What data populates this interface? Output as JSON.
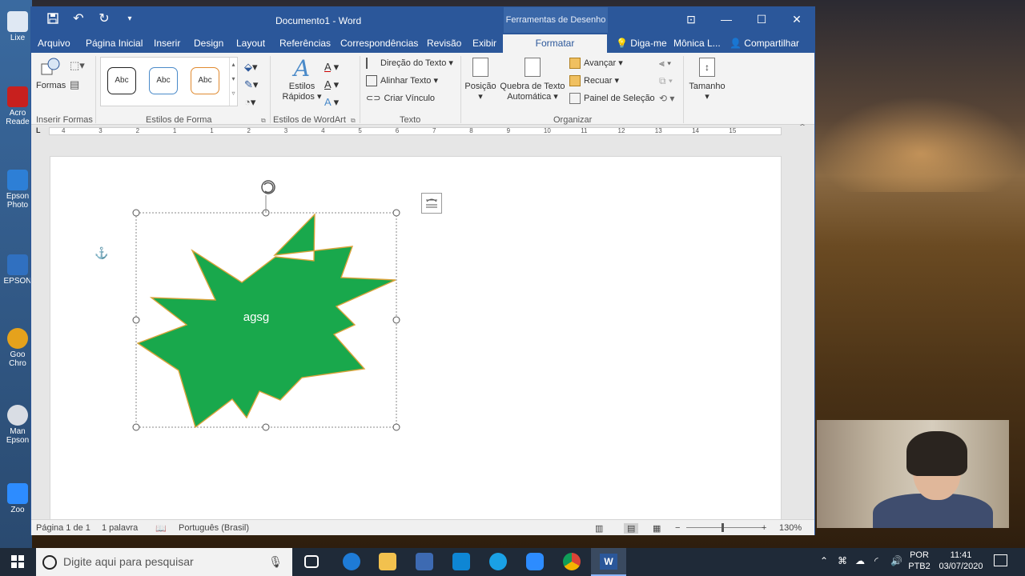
{
  "app": {
    "window_title": "Documento1 - Word",
    "context_tools": "Ferramentas de Desenho"
  },
  "tabs": {
    "arquivo": "Arquivo",
    "inicio": "Página Inicial",
    "inserir": "Inserir",
    "design": "Design",
    "layout": "Layout",
    "referencias": "Referências",
    "correspondencias": "Correspondências",
    "revisao": "Revisão",
    "exibir": "Exibir",
    "formatar": "Formatar",
    "diga_me": "Diga-me",
    "user": "Mônica L...",
    "compartilhar": "Compartilhar"
  },
  "ribbon": {
    "formas": "Formas",
    "style1": "Abc",
    "style2": "Abc",
    "style3": "Abc",
    "estilos": "Estilos",
    "rapidos": "Rápidos",
    "direcao_texto": "Direção do Texto",
    "alinhar_texto": "Alinhar Texto",
    "criar_vinculo": "Criar Vínculo",
    "posicao": "Posição",
    "quebra_texto": "Quebra de Texto",
    "automatica": "Automática",
    "avancar": "Avançar",
    "recuar": "Recuar",
    "painel_selecao": "Painel de Seleção",
    "tamanho": "Tamanho",
    "groups": {
      "inserir_formas": "Inserir Formas",
      "estilos_forma": "Estilos de Forma",
      "estilos_wordart": "Estilos de WordArt",
      "texto": "Texto",
      "organizar": "Organizar"
    }
  },
  "ruler": {
    "numbers": [
      "4",
      "3",
      "2",
      "1",
      "1",
      "2",
      "3",
      "4",
      "5",
      "6",
      "7",
      "8",
      "9",
      "10",
      "11",
      "12",
      "13",
      "14",
      "15"
    ],
    "vnumbers": [
      "3",
      "2",
      "1",
      "1",
      "2",
      "3",
      "4",
      "5",
      "6"
    ]
  },
  "document": {
    "shape_text": "agsg",
    "shape_fill": "#19a84c",
    "shape_outline": "#d9a33a"
  },
  "status": {
    "page": "Página 1 de 1",
    "words": "1 palavra",
    "language": "Português (Brasil)",
    "zoom": "130%"
  },
  "desktop_icons": [
    {
      "label": "Lixe",
      "color": "#dfe8f3"
    },
    {
      "label": "Acro Reade",
      "color": "#c8201e"
    },
    {
      "label": "Epson Photo",
      "color": "#2d7fd6"
    },
    {
      "label": "EPSON",
      "color": "#3070c0"
    },
    {
      "label": "Goo Chro",
      "color": "#e5a21c"
    },
    {
      "label": "Man Epson",
      "color": "#d9dde4"
    },
    {
      "label": "Zoo",
      "color": "#2d8cff"
    }
  ],
  "taskbar": {
    "search_placeholder": "Digite aqui para pesquisar",
    "lang": "POR",
    "layout": "PTB2",
    "time": "11:41",
    "date": "03/07/2020"
  },
  "colors": {
    "word_blue": "#2b579a",
    "taskbar": "#1f2a38"
  }
}
